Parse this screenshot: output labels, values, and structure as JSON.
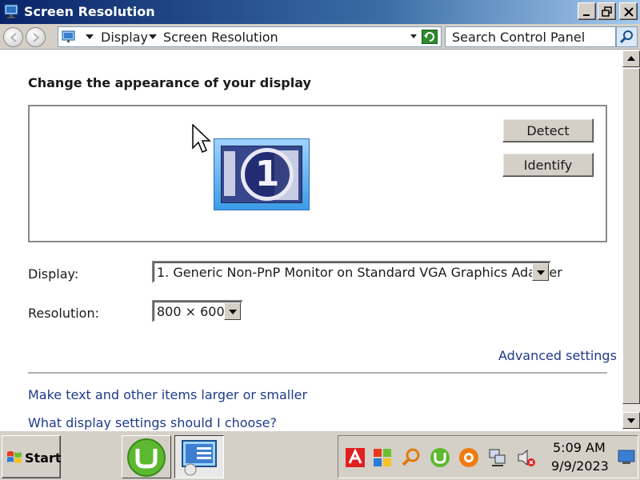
{
  "window": {
    "title": "Screen Resolution",
    "icon": "display-settings-icon"
  },
  "address": {
    "breadcrumb": [
      "Display",
      "Screen Resolution"
    ],
    "search_placeholder": "Search Control Panel"
  },
  "main": {
    "heading": "Change the appearance of your display",
    "monitor_number": "1",
    "detect_label": "Detect",
    "identify_label": "Identify",
    "display_label": "Display:",
    "display_value": "1. Generic Non-PnP Monitor on Standard VGA Graphics Adapter",
    "resolution_label": "Resolution:",
    "resolution_value": "800 × 600",
    "advanced_link": "Advanced settings",
    "link_text_size": "Make text and other items larger or smaller",
    "link_help": "What display settings should I choose?"
  },
  "taskbar": {
    "start_label": "Start",
    "clock_time": "5:09 AM",
    "clock_date": "9/9/2023",
    "tray_icons": [
      "avira-icon",
      "windows-flag-icon",
      "search-magnifier-icon",
      "utorrent-icon",
      "avast-icon",
      "network-icon",
      "volume-muted-icon"
    ]
  },
  "colors": {
    "link": "#1e3a8a",
    "titlebar": "#0a246a",
    "face": "#d4d0c8"
  }
}
